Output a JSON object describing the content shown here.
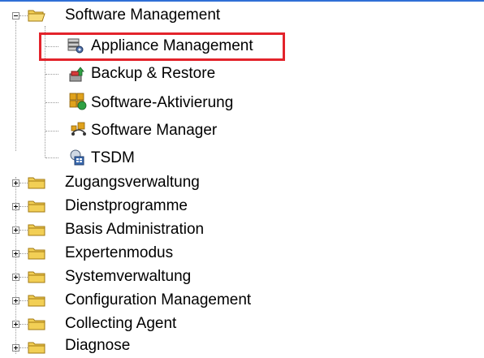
{
  "tree": {
    "parent": {
      "label": "Software Management",
      "expanded": true,
      "icon": "open-folder-icon"
    },
    "children": [
      {
        "label": "Appliance Management",
        "icon": "appliance-management-icon",
        "highlighted": true
      },
      {
        "label": "Backup & Restore",
        "icon": "backup-restore-icon"
      },
      {
        "label": "Software-Aktivierung",
        "icon": "software-activation-icon"
      },
      {
        "label": "Software Manager",
        "icon": "software-manager-icon"
      },
      {
        "label": "TSDM",
        "icon": "tsdm-icon"
      }
    ],
    "folders": [
      {
        "label": "Zugangsverwaltung"
      },
      {
        "label": "Dienstprogramme"
      },
      {
        "label": "Basis Administration"
      },
      {
        "label": "Expertenmodus"
      },
      {
        "label": "Systemverwaltung"
      },
      {
        "label": "Configuration Management"
      },
      {
        "label": "Collecting Agent"
      },
      {
        "label": "Diagnose"
      }
    ]
  },
  "colors": {
    "highlight": "#e3232b",
    "folder": "#f2cf55",
    "folder_outline": "#a27a12",
    "accent_line": "#2f6fd6"
  }
}
